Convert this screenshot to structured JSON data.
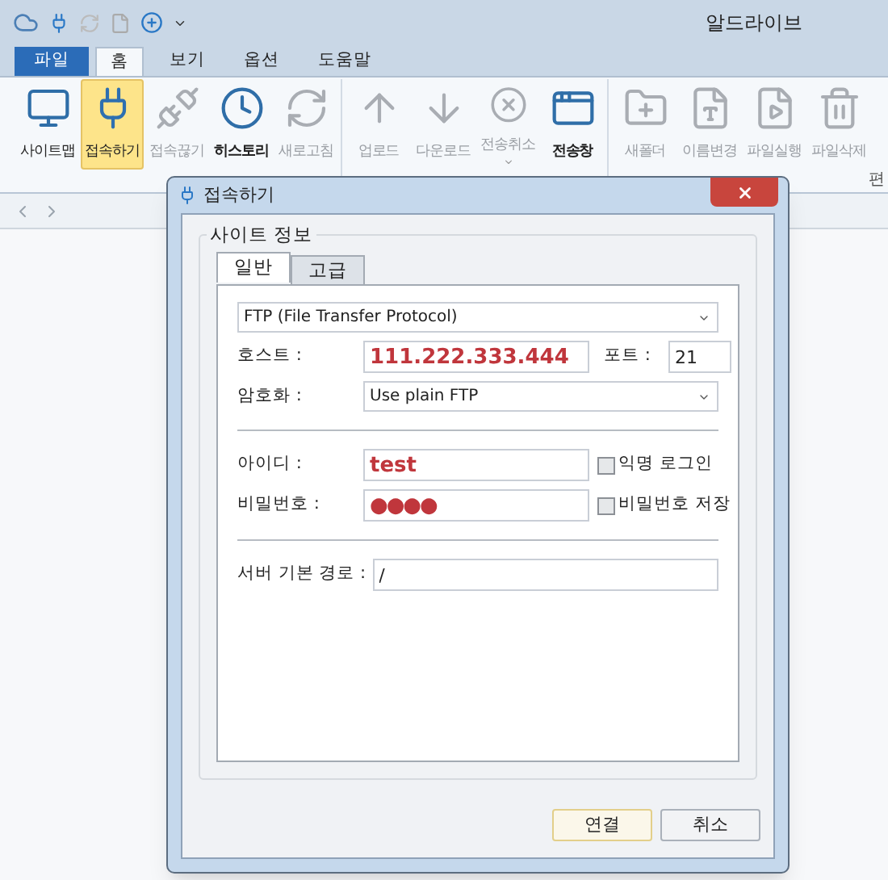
{
  "window": {
    "title": "알드라이브"
  },
  "menu_tabs": [
    {
      "label": "파일",
      "kind": "file",
      "selected": false
    },
    {
      "label": "홈",
      "kind": "tab",
      "selected": true
    },
    {
      "label": "보기",
      "kind": "tab",
      "selected": false
    },
    {
      "label": "옵션",
      "kind": "tab",
      "selected": false
    },
    {
      "label": "도움말",
      "kind": "tab",
      "selected": false
    }
  ],
  "ribbon": {
    "groups": [
      [
        {
          "label": "사이트맵",
          "disabled": false,
          "selected": false,
          "bold": false,
          "dropdown": false
        },
        {
          "label": "접속하기",
          "disabled": false,
          "selected": true,
          "bold": false,
          "dropdown": false
        },
        {
          "label": "접속끊기",
          "disabled": true,
          "selected": false,
          "bold": false,
          "dropdown": false
        },
        {
          "label": "히스토리",
          "disabled": false,
          "selected": false,
          "bold": true,
          "dropdown": false
        },
        {
          "label": "새로고침",
          "disabled": true,
          "selected": false,
          "bold": false,
          "dropdown": false
        }
      ],
      [
        {
          "label": "업로드",
          "disabled": true,
          "selected": false,
          "bold": false,
          "dropdown": false
        },
        {
          "label": "다운로드",
          "disabled": true,
          "selected": false,
          "bold": false,
          "dropdown": false
        },
        {
          "label": "전송취소",
          "disabled": true,
          "selected": false,
          "bold": false,
          "dropdown": true
        },
        {
          "label": "전송창",
          "disabled": false,
          "selected": false,
          "bold": true,
          "dropdown": false
        }
      ],
      [
        {
          "label": "새폴더",
          "disabled": true,
          "selected": false,
          "bold": false,
          "dropdown": false
        },
        {
          "label": "이름변경",
          "disabled": true,
          "selected": false,
          "bold": false,
          "dropdown": false
        },
        {
          "label": "파일실행",
          "disabled": true,
          "selected": false,
          "bold": false,
          "dropdown": false
        },
        {
          "label": "파일삭제",
          "disabled": true,
          "selected": false,
          "bold": false,
          "dropdown": false
        }
      ]
    ],
    "cut_group_label": "편"
  },
  "dialog": {
    "title": "접속하기",
    "group_title": "사이트 정보",
    "tabs": [
      {
        "label": "일반",
        "selected": true
      },
      {
        "label": "고급",
        "selected": false
      }
    ],
    "protocol": {
      "value": "FTP (File Transfer Protocol)"
    },
    "host": {
      "label": "호스트 :",
      "value": "111.222.333.444"
    },
    "port": {
      "label": "포트 :",
      "value": "21"
    },
    "encryption": {
      "label": "암호화 :",
      "value": "Use plain FTP"
    },
    "user_id": {
      "label": "아이디 :",
      "value": "test"
    },
    "anonymous_login": {
      "label": "익명 로그인",
      "checked": false
    },
    "password": {
      "label": "비밀번호 :",
      "masked_value": "●●●●"
    },
    "save_password": {
      "label": "비밀번호 저장",
      "checked": false
    },
    "server_path": {
      "label": "서버 기본 경로 :",
      "value": "/"
    },
    "buttons": [
      {
        "label": "연결",
        "default": true
      },
      {
        "label": "취소",
        "default": false
      }
    ]
  }
}
